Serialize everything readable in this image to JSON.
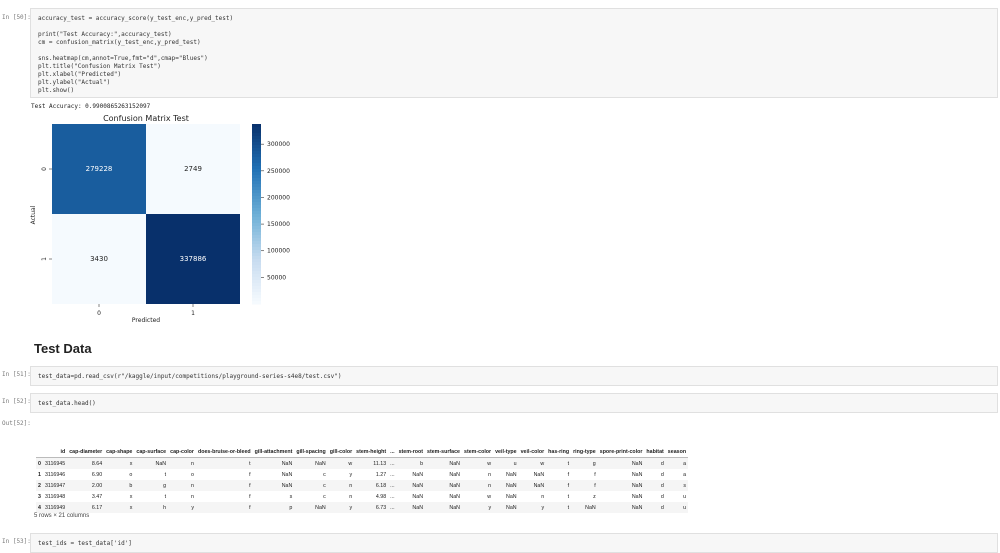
{
  "cells": {
    "c50": {
      "prompt": "In [50]:",
      "code": [
        "accuracy_test = accuracy_score(y_test_enc,y_pred_test)",
        "",
        "print(\"Test Accuracy:\",accuracy_test)",
        "cm = confusion_matrix(y_test_enc,y_pred_test)",
        "",
        "sns.heatmap(cm,annot=True,fmt=\"d\",cmap=\"Blues\")",
        "plt.title(\"Confusion Matrix Test\")",
        "plt.xlabel(\"Predicted\")",
        "plt.ylabel(\"Actual\")",
        "plt.show()"
      ],
      "output": "Test Accuracy: 0.9900865263152097"
    },
    "heading": "Test Data",
    "c51": {
      "prompt": "In [51]:",
      "code": "test_data=pd.read_csv(r\"/kaggle/input/competitions/playground-series-s4e8/test.csv\")"
    },
    "c52": {
      "prompt": "In [52]:",
      "code": "test_data.head()",
      "out_prompt": "Out[52]:"
    },
    "c53": {
      "prompt": "In [53]:",
      "code": "test_ids = test_data['id']"
    }
  },
  "chart_data": {
    "type": "heatmap",
    "title": "Confusion Matrix Test",
    "xlabel": "Predicted",
    "ylabel": "Actual",
    "x_ticks": [
      "0",
      "1"
    ],
    "y_ticks": [
      "0",
      "1"
    ],
    "values": [
      [
        279228,
        2749
      ],
      [
        3430,
        337886
      ]
    ],
    "colormap": "Blues",
    "colorbar": {
      "min": 0,
      "max": 337886,
      "ticks": [
        50000,
        100000,
        150000,
        200000,
        250000,
        300000
      ]
    }
  },
  "table": {
    "columns": [
      "",
      "id",
      "cap-diameter",
      "cap-shape",
      "cap-surface",
      "cap-color",
      "does-bruise-or-bleed",
      "gill-attachment",
      "gill-spacing",
      "gill-color",
      "stem-height",
      "...",
      "stem-root",
      "stem-surface",
      "stem-color",
      "veil-type",
      "veil-color",
      "has-ring",
      "ring-type",
      "spore-print-color",
      "habitat",
      "season"
    ],
    "rows": [
      [
        "0",
        "3116945",
        "8.64",
        "x",
        "NaN",
        "n",
        "t",
        "NaN",
        "NaN",
        "w",
        "11.13",
        "...",
        "b",
        "NaN",
        "w",
        "u",
        "w",
        "t",
        "g",
        "NaN",
        "d",
        "a"
      ],
      [
        "1",
        "3116946",
        "6.90",
        "o",
        "t",
        "o",
        "f",
        "NaN",
        "c",
        "y",
        "1.27",
        "...",
        "NaN",
        "NaN",
        "n",
        "NaN",
        "NaN",
        "f",
        "f",
        "NaN",
        "d",
        "a"
      ],
      [
        "2",
        "3116947",
        "2.00",
        "b",
        "g",
        "n",
        "f",
        "NaN",
        "c",
        "n",
        "6.18",
        "...",
        "NaN",
        "NaN",
        "n",
        "NaN",
        "NaN",
        "f",
        "f",
        "NaN",
        "d",
        "s"
      ],
      [
        "3",
        "3116948",
        "3.47",
        "x",
        "t",
        "n",
        "f",
        "s",
        "c",
        "n",
        "4.98",
        "...",
        "NaN",
        "NaN",
        "w",
        "NaN",
        "n",
        "t",
        "z",
        "NaN",
        "d",
        "u"
      ],
      [
        "4",
        "3116949",
        "6.17",
        "x",
        "h",
        "y",
        "f",
        "p",
        "NaN",
        "y",
        "6.73",
        "...",
        "NaN",
        "NaN",
        "y",
        "NaN",
        "y",
        "t",
        "NaN",
        "NaN",
        "d",
        "u"
      ]
    ],
    "info": "5 rows × 21 columns"
  }
}
